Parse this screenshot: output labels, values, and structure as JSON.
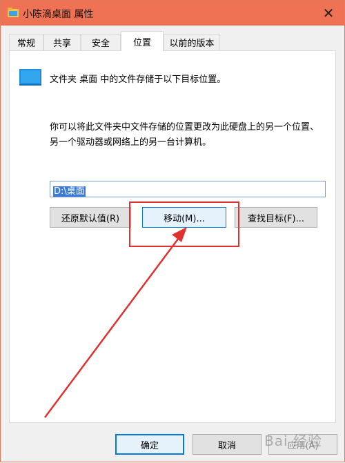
{
  "window": {
    "title": "小陈滴桌面 属性",
    "close_glyph": "✕"
  },
  "tabs": [
    {
      "label": "常规",
      "active": false
    },
    {
      "label": "共享",
      "active": false
    },
    {
      "label": "安全",
      "active": false
    },
    {
      "label": "位置",
      "active": true
    },
    {
      "label": "以前的版本",
      "active": false
    }
  ],
  "location": {
    "folder_text": "文件夹 桌面 中的文件存储于以下目标位置。",
    "help_text": "你可以将此文件夹中文件存储的位置更改为此硬盘上的另一个位置、另一个驱动器或网络上的另一台计算机。",
    "path_value": "D:\\桌面",
    "restore_default_label": "还原默认值(R)",
    "move_label": "移动(M)...",
    "find_target_label": "查找目标(F)..."
  },
  "footer": {
    "ok_label": "确定",
    "cancel_label": "取消",
    "apply_label": "应用(A)"
  },
  "watermark": "Bai 经验",
  "colors": {
    "titlebar": "#f07254",
    "annotation": "#e03131",
    "selection": "#3b7ad6"
  }
}
